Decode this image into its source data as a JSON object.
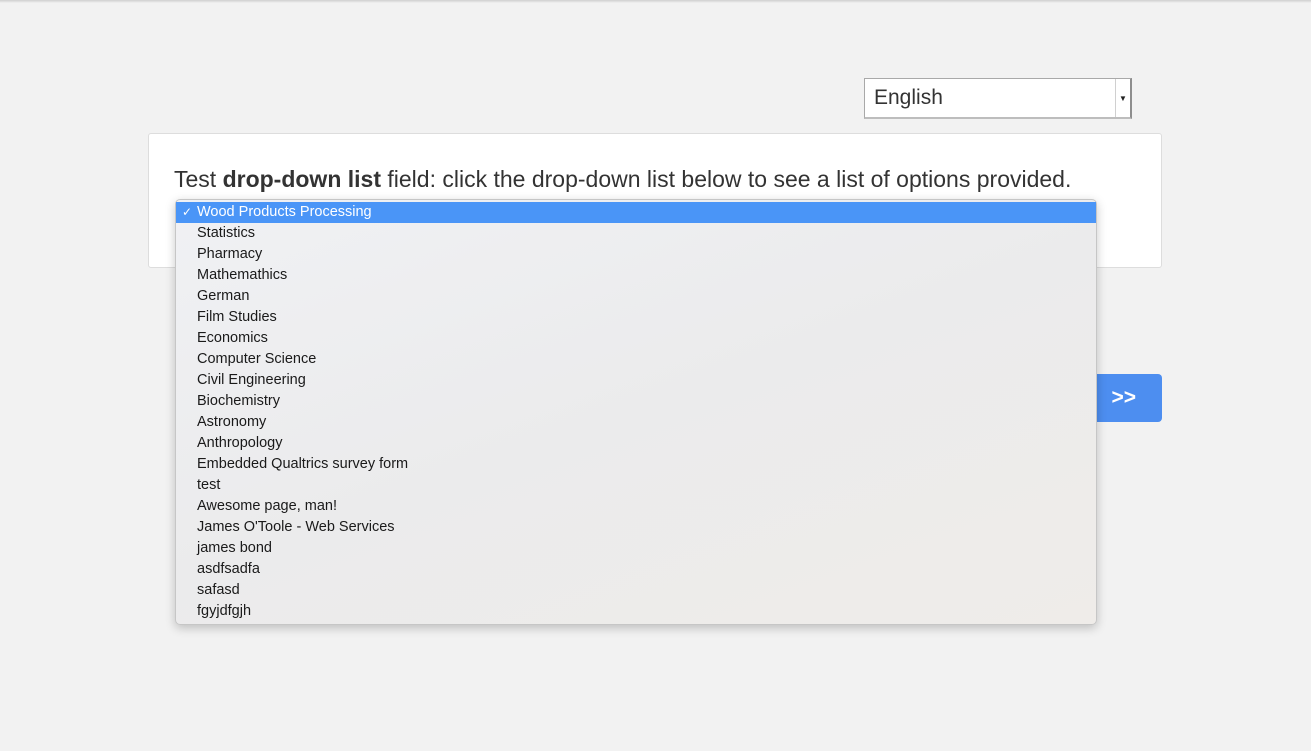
{
  "language_select": {
    "value": "English",
    "arrow_icon": "caret-down-icon"
  },
  "question": {
    "prefix": "Test ",
    "bold": "drop-down list",
    "suffix": " field: click the drop-down list below to see a list of options provided."
  },
  "dropdown": {
    "check_mark": "✓",
    "selected_index": 0,
    "options": [
      "Wood Products Processing",
      "Statistics",
      "Pharmacy",
      "Mathemathics",
      "German",
      "Film Studies",
      "Economics",
      "Computer Science",
      "Civil Engineering",
      "Biochemistry",
      "Astronomy",
      "Anthropology",
      "Embedded Qualtrics survey form",
      "test",
      "Awesome page, man!",
      "James O'Toole - Web Services",
      "james bond",
      "asdfsadfa",
      "safasd",
      "fgyjdfgjh"
    ]
  },
  "next_button": {
    "label": ">>"
  },
  "colors": {
    "accent": "#4d8ef0",
    "selection": "#4a95f7",
    "page_background": "#f2f2f2"
  }
}
